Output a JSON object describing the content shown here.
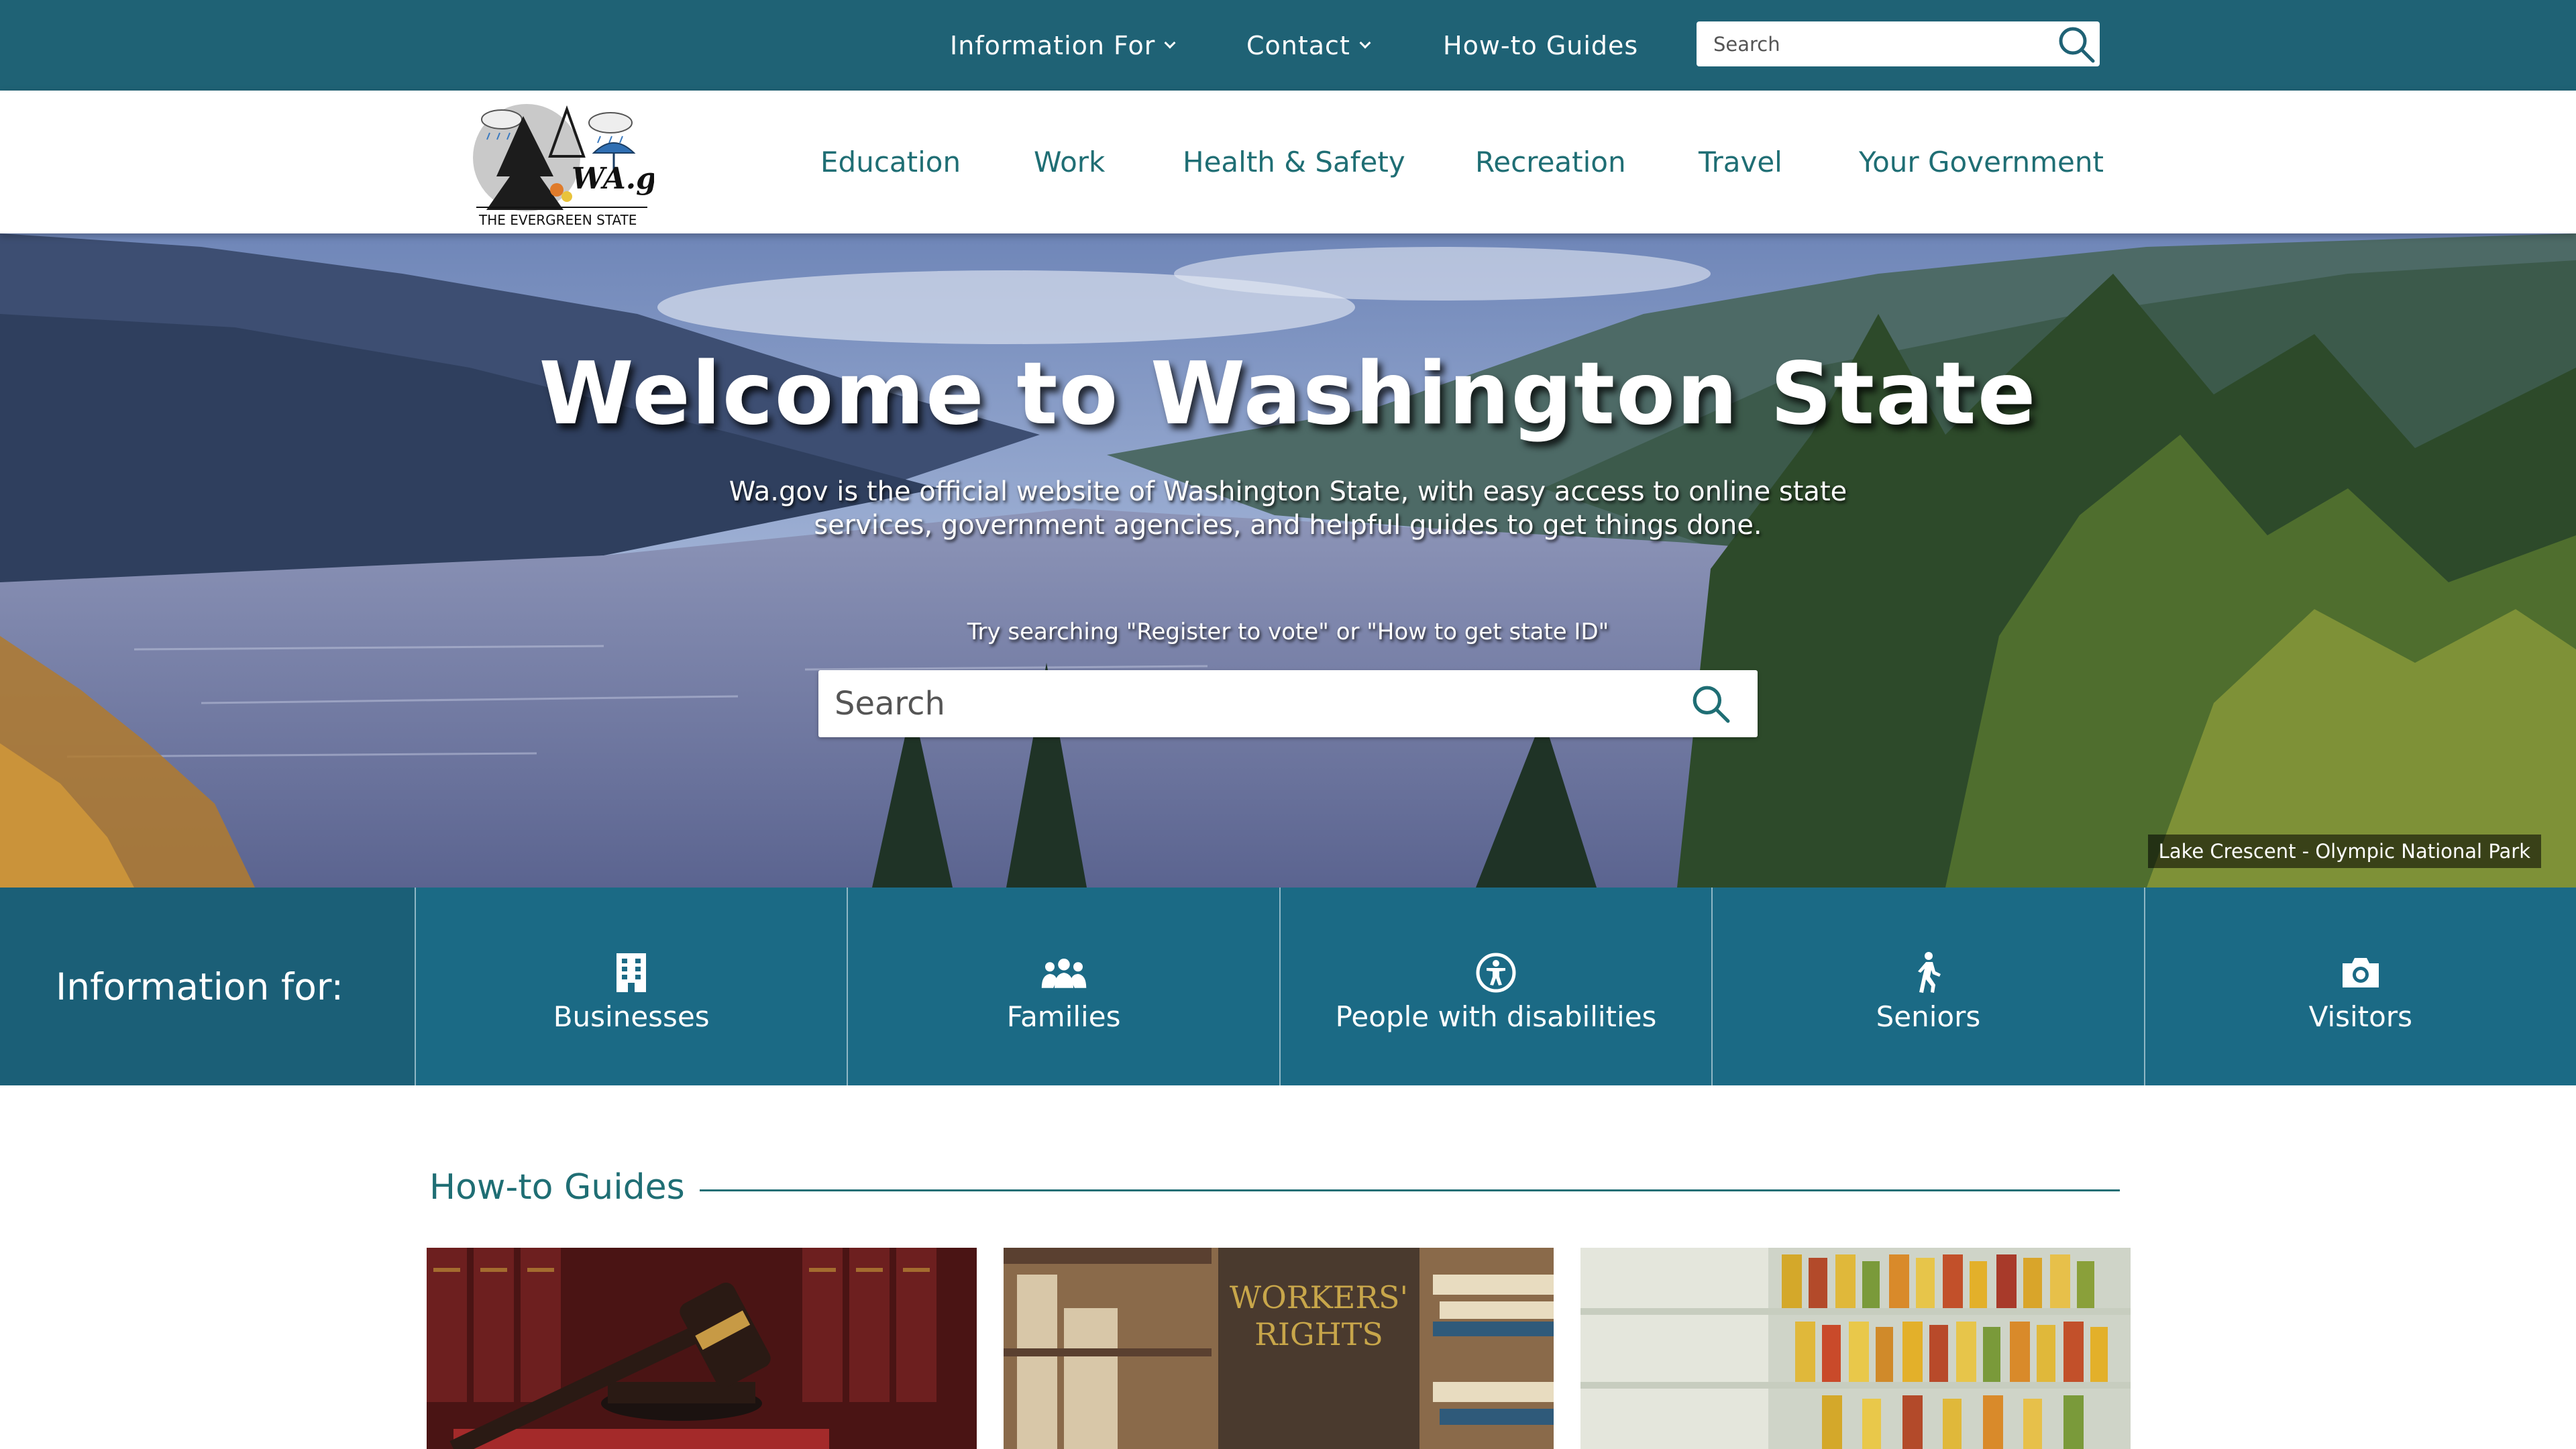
{
  "topbar": {
    "items": [
      {
        "label": "Information For",
        "has_dropdown": true
      },
      {
        "label": "Contact",
        "has_dropdown": true
      },
      {
        "label": "How-to Guides",
        "has_dropdown": false
      }
    ],
    "search": {
      "placeholder": "Search",
      "icon": "search-icon"
    }
  },
  "logo": {
    "text": "WA.gov",
    "tagline": "THE EVERGREEN STATE"
  },
  "mainnav": {
    "items": [
      {
        "label": "Education"
      },
      {
        "label": "Work"
      },
      {
        "label": "Health & Safety"
      },
      {
        "label": "Recreation"
      },
      {
        "label": "Travel"
      },
      {
        "label": "Your Government"
      }
    ]
  },
  "hero": {
    "title": "Welcome to Washington State",
    "subtitle": "Wa.gov is the official website of Washington State, with easy access to online state services, government agencies, and helpful guides to get things done.",
    "hint": "Try searching \"Register to vote\" or \"How to get state ID\"",
    "search_placeholder": "Search",
    "photo_credit": "Lake Crescent - Olympic National Park"
  },
  "info_for": {
    "label": "Information for:",
    "tiles": [
      {
        "label": "Businesses",
        "icon": "building-icon"
      },
      {
        "label": "Families",
        "icon": "family-icon"
      },
      {
        "label": "People with disabilities",
        "icon": "accessibility-icon"
      },
      {
        "label": "Seniors",
        "icon": "walking-person-icon"
      },
      {
        "label": "Visitors",
        "icon": "camera-icon"
      }
    ]
  },
  "guides": {
    "title": "How-to Guides",
    "cards": [
      {
        "image": "gavel-law-books"
      },
      {
        "image": "workers-rights-book",
        "image_text_line1": "WORKERS'",
        "image_text_line2": "RIGHTS"
      },
      {
        "image": "grocery-shelves"
      }
    ]
  },
  "colors": {
    "topbar": "#1f6275",
    "nav_text": "#1f6e74",
    "info_band": "#1b6a85",
    "info_label_bg": "#1b5f77"
  }
}
